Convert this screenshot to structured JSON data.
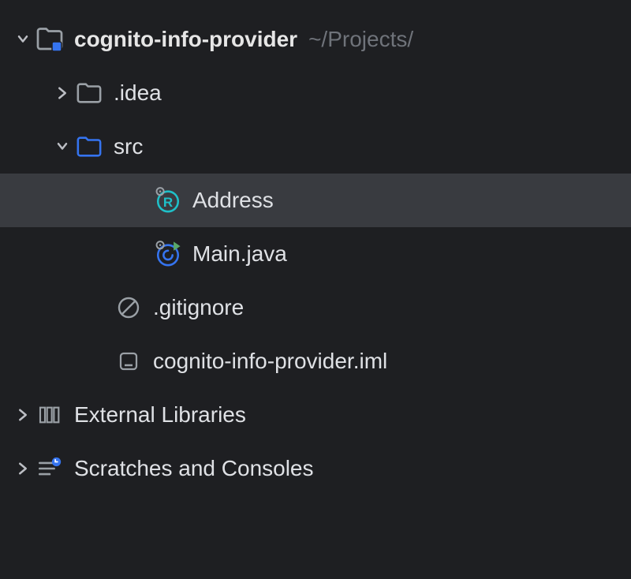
{
  "project": {
    "name": "cognito-info-provider",
    "path_hint": "~/Projects/"
  },
  "tree": {
    "idea_folder": ".idea",
    "src_folder": "src",
    "address_file": "Address",
    "main_file": "Main.java",
    "gitignore_file": ".gitignore",
    "iml_file": "cognito-info-provider.iml",
    "external_libraries": "External Libraries",
    "scratches": "Scratches and Consoles"
  },
  "colors": {
    "bg": "#1e1f22",
    "selected": "#393b40",
    "text": "#dfe1e5",
    "muted": "#6f737a",
    "folder_blue": "#3574f0",
    "folder_gray": "#9aa0a6",
    "record_cyan": "#1fc0c8",
    "runnable_green": "#59a869"
  }
}
